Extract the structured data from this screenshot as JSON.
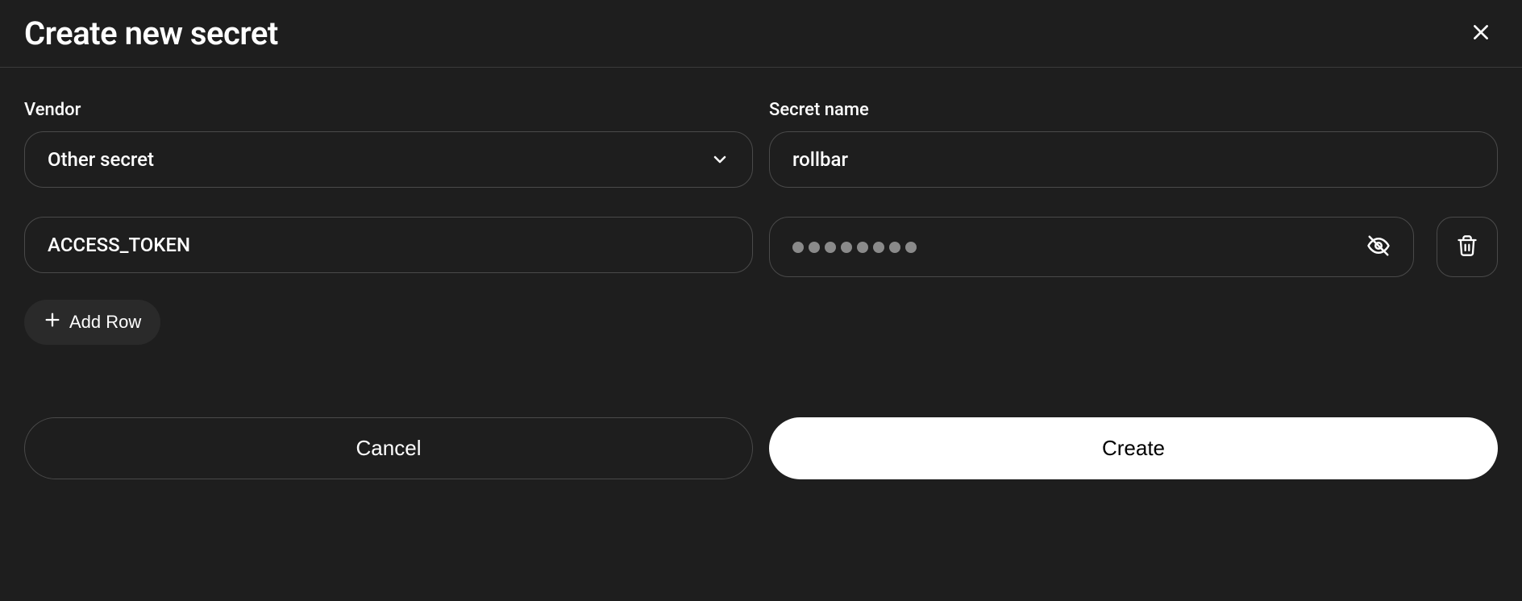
{
  "header": {
    "title": "Create new secret"
  },
  "form": {
    "vendor": {
      "label": "Vendor",
      "selected": "Other secret"
    },
    "secretName": {
      "label": "Secret name",
      "value": "rollbar"
    }
  },
  "rows": [
    {
      "key": "ACCESS_TOKEN",
      "value_masked_length": 8
    }
  ],
  "actions": {
    "addRow": "Add Row",
    "cancel": "Cancel",
    "create": "Create"
  }
}
